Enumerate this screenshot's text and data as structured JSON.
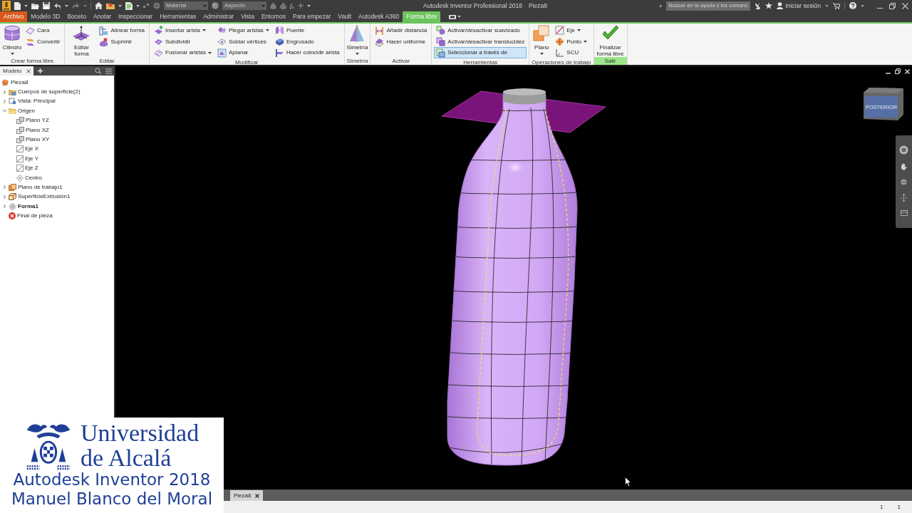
{
  "title_bar": {
    "material": {
      "placeholder": "Material",
      "disabled": true
    },
    "appearance": {
      "placeholder": "Aspecto",
      "disabled": true
    },
    "parameters_button": "f$_{x}$",
    "title": "Autodesk Inventor Professional 2018",
    "document": "Pieza8",
    "search": {
      "placeholder": "Buscar en la ayuda y los comanc"
    },
    "sign_in": "Iniciar sesión"
  },
  "tabs": [
    {
      "label": "Archivo",
      "kind": "file",
      "selected": false
    },
    {
      "label": "Modelo 3D",
      "kind": "standard",
      "selected": false
    },
    {
      "label": "Boceto",
      "kind": "standard",
      "selected": false
    },
    {
      "label": "Anotar",
      "kind": "standard",
      "selected": false
    },
    {
      "label": "Inspeccionar",
      "kind": "standard",
      "selected": false
    },
    {
      "label": "Herramientas",
      "kind": "standard",
      "selected": false
    },
    {
      "label": "Administrar",
      "kind": "standard",
      "selected": false
    },
    {
      "label": "Vista",
      "kind": "standard",
      "selected": false
    },
    {
      "label": "Entornos",
      "kind": "standard",
      "selected": false
    },
    {
      "label": "Para empezar",
      "kind": "standard",
      "selected": false
    },
    {
      "label": "Vault",
      "kind": "standard",
      "selected": false
    },
    {
      "label": "Autodesk A360",
      "kind": "standard",
      "selected": false
    },
    {
      "label": "Forma libre",
      "kind": "contextual",
      "selected": true
    }
  ],
  "ribbon": {
    "panels": [
      {
        "title": "Crear forma libre",
        "highlighted": false,
        "groups": [
          {
            "kind": "large",
            "label": "Cilindro",
            "dropdown": true
          },
          {
            "kind": "stack",
            "items": [
              {
                "label": "Cara",
                "dropdown": false
              },
              {
                "label": "Convertir",
                "dropdown": false
              }
            ]
          }
        ]
      },
      {
        "title": "Editar",
        "highlighted": false,
        "groups": [
          {
            "kind": "large",
            "label": "Editar forma",
            "dropdown": false
          },
          {
            "kind": "stack",
            "items": [
              {
                "label": "Alinear forma",
                "dropdown": false
              },
              {
                "label": "Suprimir",
                "dropdown": false
              }
            ]
          }
        ]
      },
      {
        "title": "Modificar",
        "highlighted": false,
        "groups": [
          {
            "kind": "stack",
            "items": [
              {
                "label": "Insertar arista",
                "dropdown": true
              },
              {
                "label": "Subdividir",
                "dropdown": false
              },
              {
                "label": "Fusionar aristas",
                "dropdown": true
              }
            ]
          },
          {
            "kind": "stack",
            "items": [
              {
                "label": "Plegar aristas",
                "dropdown": true
              },
              {
                "label": "Soldar vértices",
                "dropdown": false
              },
              {
                "label": "Aplanar",
                "dropdown": false
              }
            ]
          },
          {
            "kind": "stack",
            "items": [
              {
                "label": "Puente",
                "dropdown": false
              },
              {
                "label": "Engrosado",
                "dropdown": false
              },
              {
                "label": "Hacer coincidir arista",
                "dropdown": false
              }
            ]
          }
        ]
      },
      {
        "title": "Simetría",
        "highlighted": false,
        "groups": [
          {
            "kind": "large",
            "label": "Simetría",
            "dropdown": true
          }
        ]
      },
      {
        "title": "Activar",
        "highlighted": false,
        "groups": [
          {
            "kind": "stack",
            "items": [
              {
                "label": "Añadir distancia",
                "dropdown": false
              },
              {
                "label": "Hacer uniforme",
                "dropdown": false
              }
            ]
          }
        ]
      },
      {
        "title": "Herramientas",
        "highlighted": false,
        "groups": [
          {
            "kind": "stack",
            "items": [
              {
                "label": "Activar/desactivar suavizado",
                "dropdown": false,
                "on": false
              },
              {
                "label": "Activar/desactivar translucidez",
                "dropdown": false,
                "on": false
              },
              {
                "label": "Seleccionar a través de",
                "dropdown": false,
                "on": true
              }
            ]
          }
        ]
      },
      {
        "title": "Operaciones de trabajo",
        "highlighted": false,
        "groups": [
          {
            "kind": "large",
            "label": "Plano",
            "dropdown": true
          },
          {
            "kind": "stack",
            "items": [
              {
                "label": "Eje",
                "dropdown": true
              },
              {
                "label": "Punto",
                "dropdown": true
              },
              {
                "label": "SCU",
                "dropdown": false
              }
            ]
          }
        ]
      },
      {
        "title": "Salir",
        "highlighted": true,
        "groups": [
          {
            "kind": "large",
            "label": "Finalizar forma libre",
            "dropdown": false
          }
        ]
      }
    ]
  },
  "browser": {
    "tabs": [
      {
        "label": "Modelo",
        "selected": true
      }
    ],
    "tree": [
      {
        "label": "Pieza8",
        "kind": "part",
        "active": false,
        "children": [
          {
            "label": "Cuerpos de superficie(2)",
            "kind": "bodies",
            "expanded": false,
            "active": false
          },
          {
            "label": "Vista: Principal",
            "kind": "view",
            "expanded": false,
            "active": false
          },
          {
            "label": "Origen",
            "kind": "folder",
            "expanded": true,
            "active": false,
            "children": [
              {
                "label": "Plano YZ",
                "kind": "plane",
                "active": false
              },
              {
                "label": "Plano XZ",
                "kind": "plane",
                "active": false
              },
              {
                "label": "Plano XY",
                "kind": "plane",
                "active": false
              },
              {
                "label": "Eje X",
                "kind": "axis",
                "active": false
              },
              {
                "label": "Eje Y",
                "kind": "axis",
                "active": false
              },
              {
                "label": "Eje Z",
                "kind": "axis",
                "active": false
              },
              {
                "label": "Centro",
                "kind": "point",
                "active": false
              }
            ]
          },
          {
            "label": "Plano de trabajo1",
            "kind": "workplane",
            "expanded": false,
            "active": false
          },
          {
            "label": "SuperficieExtrusión1",
            "kind": "extrusion",
            "expanded": false,
            "active": false
          },
          {
            "label": "Forma1",
            "kind": "form",
            "expanded": false,
            "active": true
          },
          {
            "label": "Final de pieza",
            "kind": "end",
            "active": false
          }
        ]
      }
    ]
  },
  "viewport": {
    "view_cube_label": "POSTERIOR"
  },
  "document_tabs": [
    {
      "label": "Pieza8",
      "selected": true
    }
  ],
  "status_bar": {
    "fields": [
      "1",
      "1"
    ]
  },
  "overlay": {
    "institution": [
      "Universidad",
      "de Alcalá"
    ],
    "course": "Autodesk Inventor 2018",
    "author": "Manuel Blanco del Moral"
  }
}
